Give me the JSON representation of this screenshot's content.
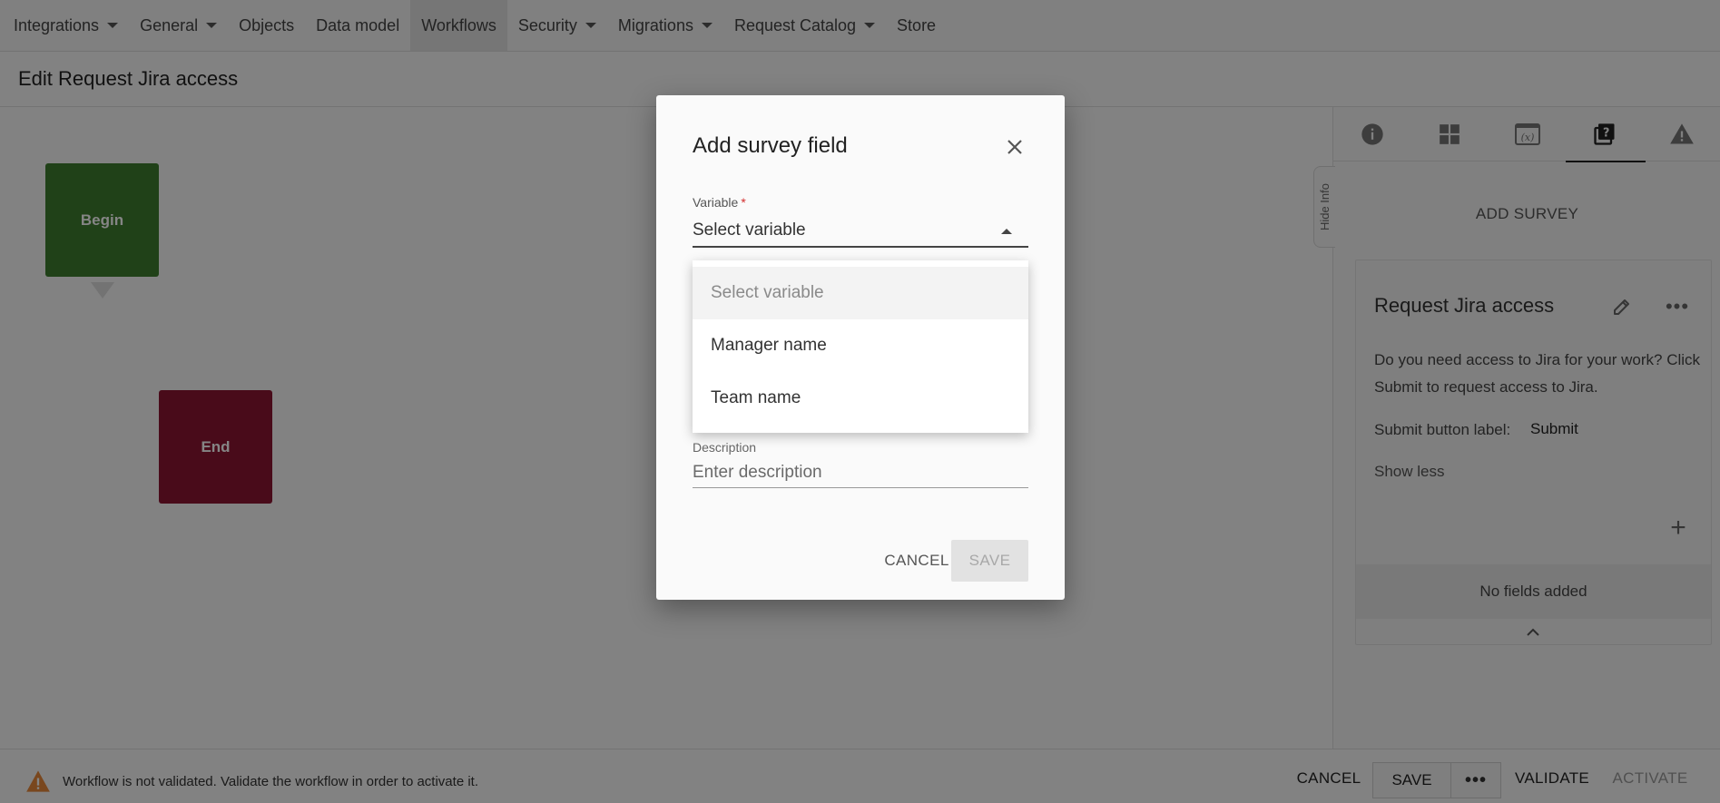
{
  "topnav": {
    "items": [
      {
        "label": "Integrations",
        "dropdown": true
      },
      {
        "label": "General",
        "dropdown": true
      },
      {
        "label": "Objects",
        "dropdown": false
      },
      {
        "label": "Data model",
        "dropdown": false
      },
      {
        "label": "Workflows",
        "dropdown": false,
        "active": true
      },
      {
        "label": "Security",
        "dropdown": true
      },
      {
        "label": "Migrations",
        "dropdown": true
      },
      {
        "label": "Request Catalog",
        "dropdown": true
      },
      {
        "label": "Store",
        "dropdown": false
      }
    ]
  },
  "page": {
    "title": "Edit Request Jira access"
  },
  "canvas": {
    "begin_label": "Begin",
    "end_label": "End",
    "begin_color": "#3f7d2e",
    "end_color": "#8c1632"
  },
  "right_panel": {
    "tabs": [
      {
        "icon": "info-icon"
      },
      {
        "icon": "dashboard-icon"
      },
      {
        "icon": "variables-icon"
      },
      {
        "icon": "survey-icon",
        "active": true
      },
      {
        "icon": "warning-icon"
      }
    ],
    "hide_info_label": "Hide Info",
    "add_survey_label": "ADD SURVEY",
    "survey": {
      "title": "Request Jira access",
      "description": "Do you need access to Jira for your work? Click Submit to request access to Jira.",
      "submit_label_caption": "Submit button label:",
      "submit_label_value": "Submit",
      "show_less": "Show less",
      "no_fields": "No fields added"
    }
  },
  "footer": {
    "warning_text": "Workflow is not validated. Validate the workflow in order to activate it.",
    "cancel": "CANCEL",
    "save": "SAVE",
    "validate": "VALIDATE",
    "activate": "ACTIVATE"
  },
  "dialog": {
    "title": "Add survey field",
    "variable_label": "Variable",
    "required_mark": "*",
    "variable_value": "Select variable",
    "description_label": "Description",
    "description_placeholder": "Enter description",
    "cancel": "CANCEL",
    "save": "SAVE",
    "dropdown_options": [
      "Select variable",
      "Manager name",
      "Team name"
    ]
  }
}
